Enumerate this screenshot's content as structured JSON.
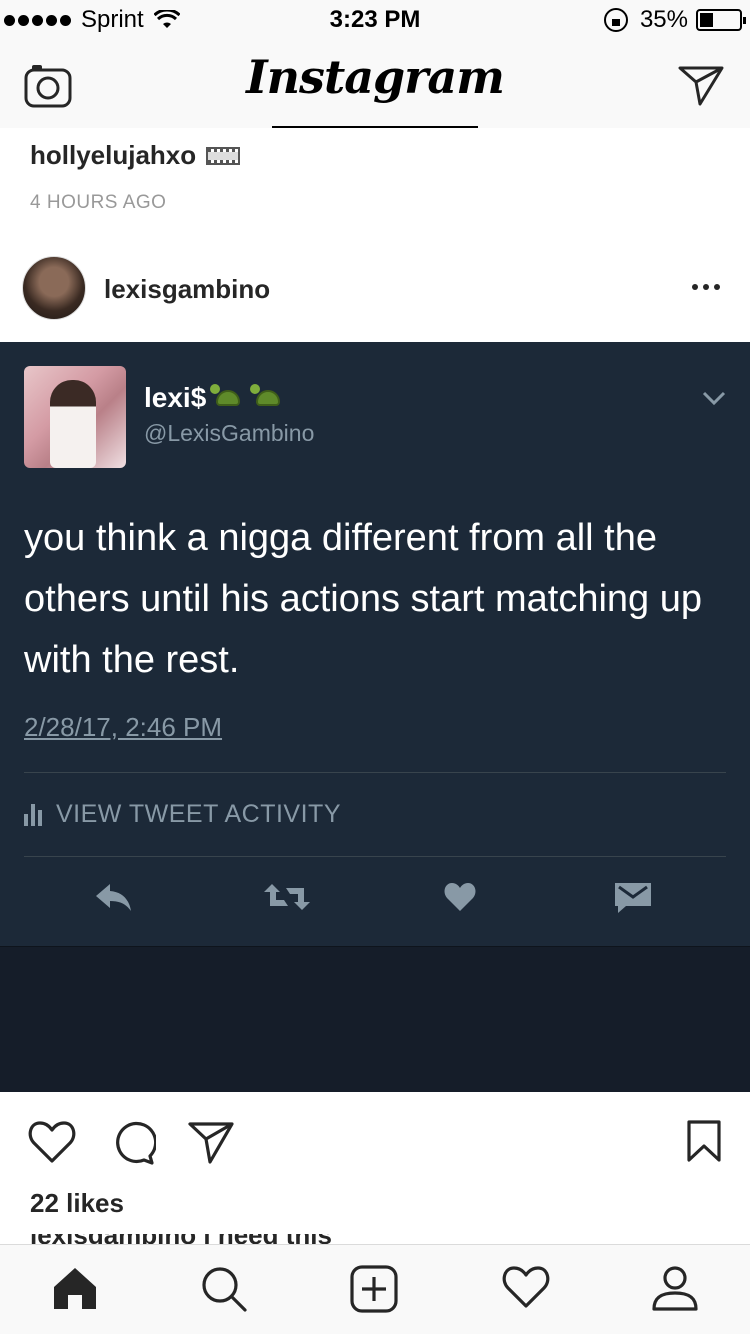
{
  "status_bar": {
    "carrier": "Sprint",
    "time": "3:23 PM",
    "battery": "35%",
    "battery_level": 0.35
  },
  "nav": {
    "title": "Instagram",
    "camera_icon": "camera-icon",
    "direct_icon": "paper-plane-icon"
  },
  "previous_post": {
    "username": "hollyelujahxo",
    "badge_icon": "film-icon",
    "time_ago": "4 HOURS AGO"
  },
  "post": {
    "username": "lexisgambino",
    "more_icon": "more-dots-icon",
    "tweet": {
      "name": "lexi$",
      "name_emoji": "turtle-emoji",
      "handle": "@LexisGambino",
      "text": "you think a nigga different from all the others until his actions start matching up with the rest.",
      "timestamp": "2/28/17, 2:46 PM",
      "activity_label": "VIEW TWEET ACTIVITY",
      "colors": {
        "background": "#1c2938",
        "text": "#ffffff",
        "muted": "#8899a6"
      }
    },
    "likes": "22 likes",
    "caption_preview": "lexisgambino i need this"
  },
  "tab_bar": [
    "home-icon",
    "search-icon",
    "add-icon",
    "heart-icon",
    "profile-icon"
  ]
}
